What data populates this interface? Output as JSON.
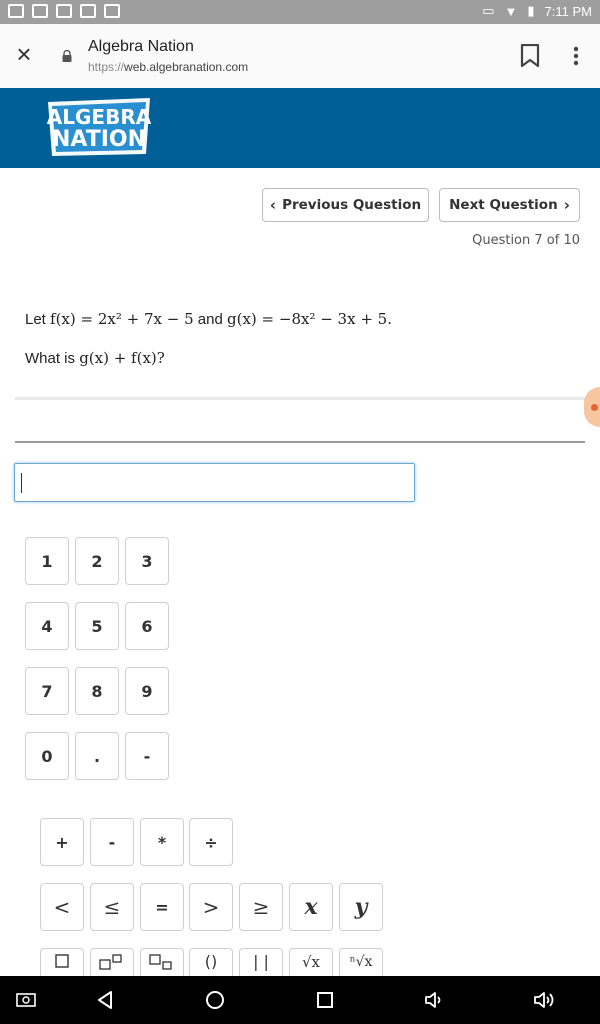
{
  "status_bar": {
    "time": "7:11 PM"
  },
  "browser": {
    "title": "Algebra Nation",
    "url_protocol": "https://",
    "url_host": "web.algebranation.com"
  },
  "brand": {
    "logo_line1": "ALGEBRA",
    "logo_line2": "NATION",
    "color": "#005f96"
  },
  "question_nav": {
    "prev_label": "Previous Question",
    "next_label": "Next Question",
    "counter": "Question 7 of 10"
  },
  "problem": {
    "let": "Let",
    "f_def": "f(x) = 2x² + 7x − 5",
    "and": "and",
    "g_def": "g(x) =  −8x² − 3x + 5.",
    "question_prefix": "What is",
    "question_expr": "g(x) + f(x)?"
  },
  "answer": {
    "value": ""
  },
  "numpad": [
    [
      "1",
      "2",
      "3"
    ],
    [
      "4",
      "5",
      "6"
    ],
    [
      "7",
      "8",
      "9"
    ],
    [
      "0",
      ".",
      "-"
    ]
  ],
  "operators": [
    "+",
    "-",
    "*",
    "÷"
  ],
  "comparisons": [
    "<",
    "≤",
    "=",
    ">",
    "≥",
    "x",
    "y"
  ],
  "templates": [
    "box-icon",
    "superscript-icon",
    "subscript-icon",
    "parentheses-icon",
    "absolute-value-icon",
    "square-root-icon",
    "nth-root-icon"
  ]
}
